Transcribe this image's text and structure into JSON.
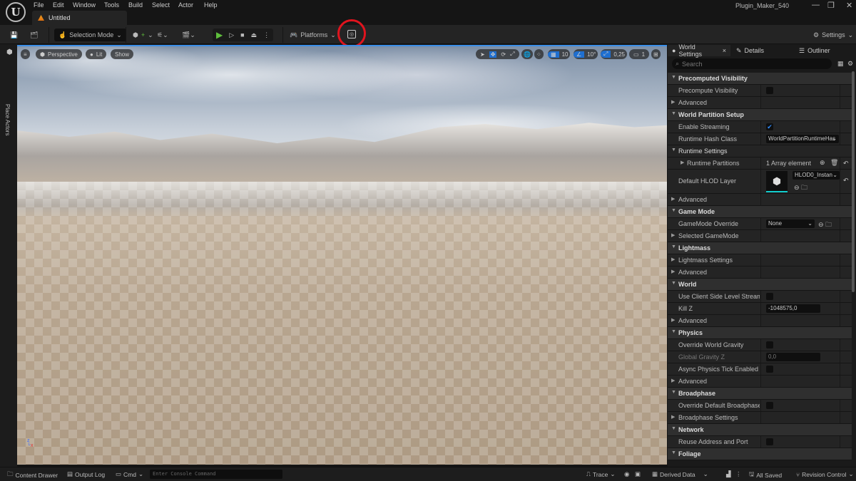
{
  "app": {
    "logo": "U",
    "title": "Plugin_Maker_540",
    "minimize": "—",
    "restore": "❐",
    "close": "✕"
  },
  "menu": [
    "File",
    "Edit",
    "Window",
    "Tools",
    "Build",
    "Select",
    "Actor",
    "Help"
  ],
  "doc_tab": "Untitled",
  "toolbar": {
    "selection_mode": "Selection Mode",
    "platforms": "Platforms",
    "settings": "Settings",
    "chevron": "⌄",
    "play": "▶",
    "step": "▷",
    "stop": "■",
    "eject": "⏏",
    "more": "⋮"
  },
  "left_strip": {
    "place_actors": "Place Actors"
  },
  "viewport": {
    "menu": "≡",
    "perspective": "Perspective",
    "lit": "Lit",
    "show": "Show",
    "grid_snap": "10",
    "rotation_snap": "10°",
    "scale_snap": "0,25",
    "camera_speed": "1",
    "axis_z": "z",
    "axis_x": "x"
  },
  "panel": {
    "tabs": [
      "World Settings",
      "Details",
      "Outliner"
    ],
    "close": "×",
    "search_placeholder": "Search",
    "rows": [
      {
        "type": "hdr",
        "label": "Precomputed Visibility"
      },
      {
        "label": "Precompute Visibility",
        "check": false
      },
      {
        "type": "sub",
        "label": "Advanced"
      },
      {
        "type": "hdr",
        "label": "World Partition Setup"
      },
      {
        "label": "Enable Streaming",
        "check": true
      },
      {
        "label": "Runtime Hash Class",
        "combo": "WorldPartitionRuntimeHas"
      },
      {
        "type": "hdrsub",
        "label": "Runtime Settings"
      },
      {
        "type": "sub",
        "label": "Runtime Partitions",
        "text": "1 Array element"
      },
      {
        "type": "tall",
        "label": "Default HLOD Layer",
        "combo": "HLOD0_Instan"
      },
      {
        "type": "sub",
        "label": "Advanced"
      },
      {
        "type": "hdr",
        "label": "Game Mode"
      },
      {
        "label": "GameMode Override",
        "combo": "None"
      },
      {
        "type": "sub",
        "label": "Selected GameMode"
      },
      {
        "type": "hdr",
        "label": "Lightmass"
      },
      {
        "type": "sub",
        "label": "Lightmass Settings"
      },
      {
        "type": "sub",
        "label": "Advanced"
      },
      {
        "type": "hdr",
        "label": "World"
      },
      {
        "label": "Use Client Side Level Streaming V...",
        "check": false
      },
      {
        "label": "Kill Z",
        "field": "-1048575,0"
      },
      {
        "type": "sub",
        "label": "Advanced"
      },
      {
        "type": "hdr",
        "label": "Physics"
      },
      {
        "label": "Override World Gravity",
        "check": false
      },
      {
        "label": "Global Gravity Z",
        "field": "0,0",
        "muted": true
      },
      {
        "label": "Async Physics Tick Enabled",
        "check": false
      },
      {
        "type": "sub",
        "label": "Advanced"
      },
      {
        "type": "hdr",
        "label": "Broadphase"
      },
      {
        "label": "Override Default Broadphase Setti...",
        "check": false
      },
      {
        "type": "sub",
        "label": "Broadphase Settings"
      },
      {
        "type": "hdr",
        "label": "Network"
      },
      {
        "label": "Reuse Address and Port",
        "check": false
      },
      {
        "type": "hdr",
        "label": "Foliage"
      }
    ]
  },
  "statusbar": {
    "content_drawer": "Content Drawer",
    "output_log": "Output Log",
    "cmd": "Cmd",
    "console_placeholder": "Enter Console Command",
    "trace": "Trace",
    "derived_data": "Derived Data",
    "all_saved": "All Saved",
    "revision_control": "Revision Control"
  },
  "colors": {
    "accent": "#1f6fd0",
    "highlight_circle": "#e0141e",
    "play": "#5fbf3c"
  }
}
